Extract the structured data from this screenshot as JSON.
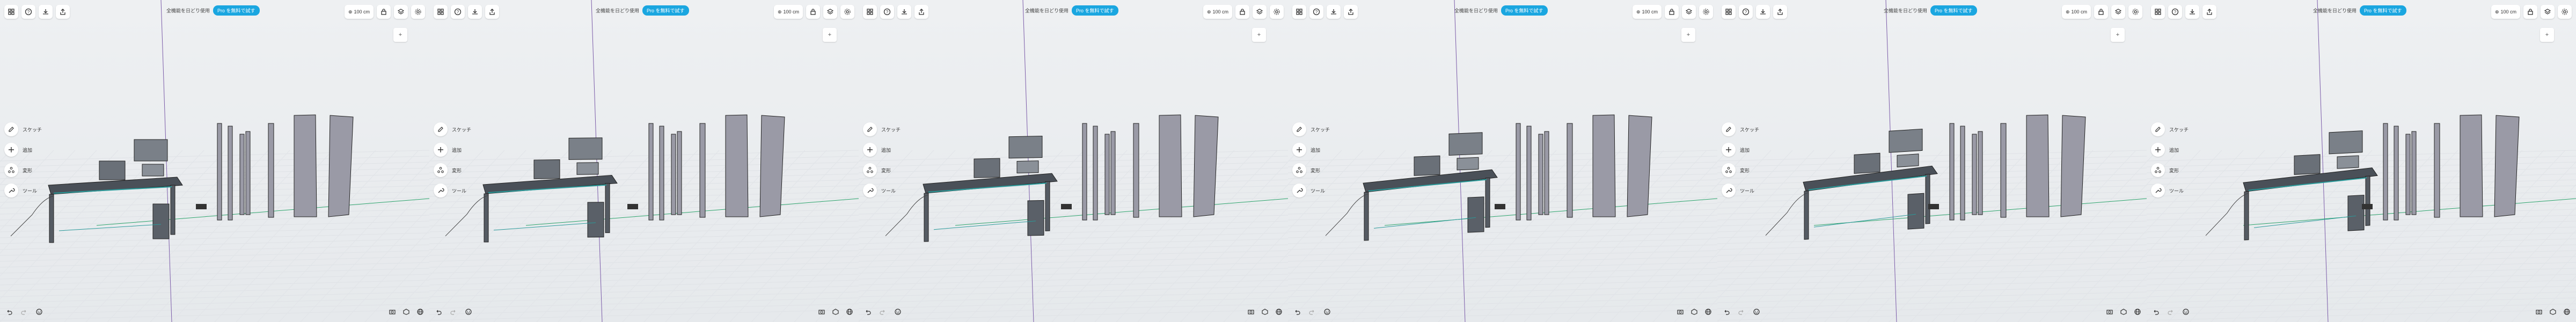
{
  "app": {
    "plan_text": "全機能を日どり使用",
    "pro_badge": "Pro を無料で試す",
    "zoom_label": "100 cm",
    "tools": [
      {
        "key": "sketch",
        "label": "スケッチ",
        "icon": "pencil-icon"
      },
      {
        "key": "add",
        "label": "追加",
        "icon": "plus-icon"
      },
      {
        "key": "edit",
        "label": "変形",
        "icon": "edit-nodes-icon"
      },
      {
        "key": "tool",
        "label": "ツール",
        "icon": "wrench-icon"
      }
    ],
    "top_left_icons": [
      "menu-icon",
      "help-icon",
      "download-icon",
      "share-icon"
    ],
    "top_right_icons": [
      "lock-icon",
      "layers-icon",
      "settings-icon"
    ],
    "bottom_left_icons": [
      "undo-icon",
      "redo-icon",
      "view-icon"
    ],
    "bottom_right_icons": [
      "camera-icon",
      "mode-icon",
      "globe-icon"
    ],
    "colors": {
      "accent": "#1aa6e0",
      "panel": "#ffffff",
      "model_fill": "#9a9aa6",
      "model_dark": "#444a52",
      "teal": "#2a9a9a"
    }
  },
  "frames": [
    {
      "name": "view-1"
    },
    {
      "name": "view-2"
    },
    {
      "name": "view-3"
    },
    {
      "name": "view-4"
    },
    {
      "name": "view-5"
    },
    {
      "name": "view-6"
    }
  ]
}
